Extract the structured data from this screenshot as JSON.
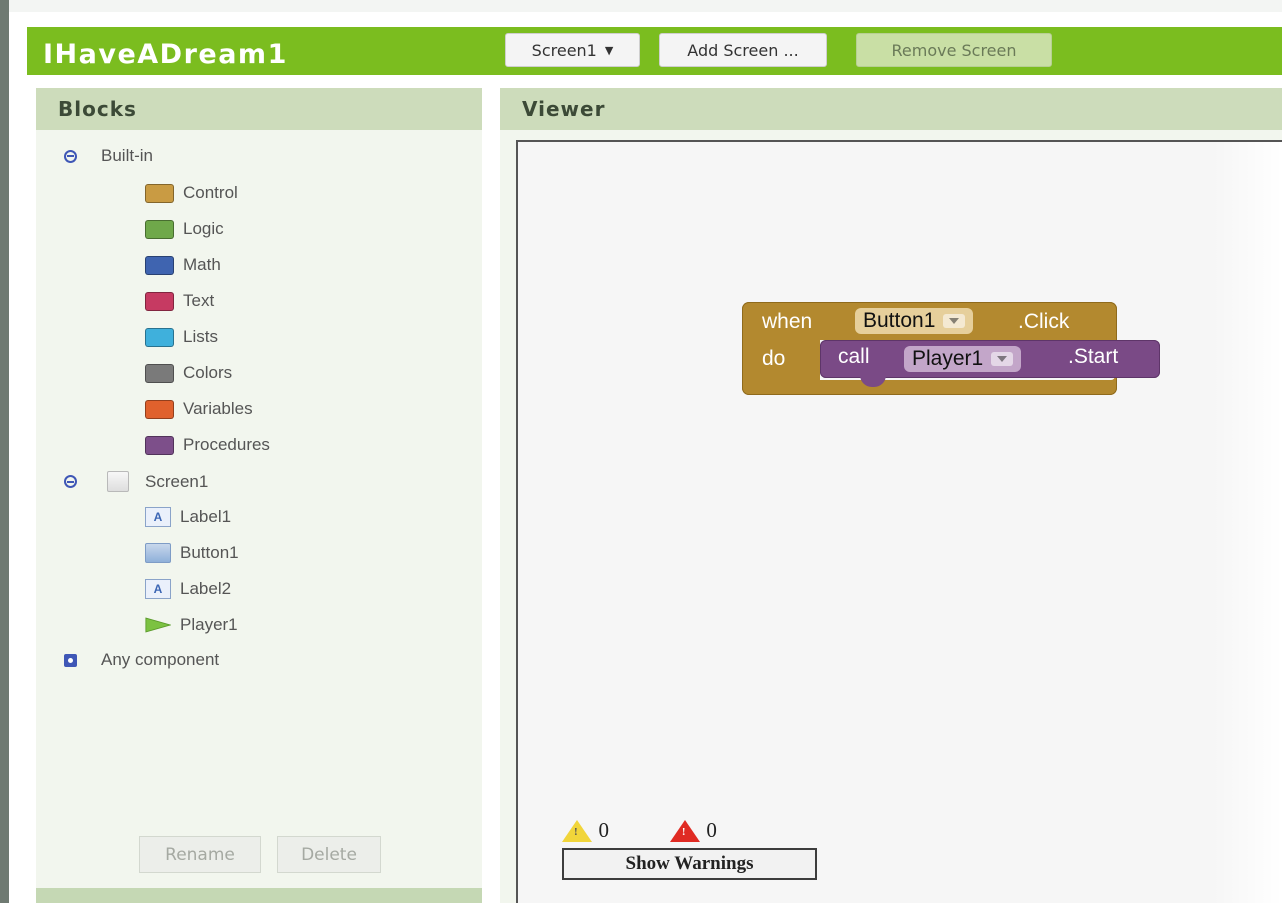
{
  "app": {
    "title": "IHaveADream1"
  },
  "toolbar": {
    "screen_select": "Screen1",
    "add_screen": "Add Screen ...",
    "remove_screen": "Remove Screen"
  },
  "blocks_panel": {
    "header": "Blocks",
    "builtin_label": "Built-in",
    "builtin_items": [
      {
        "label": "Control",
        "color": "#c99b43"
      },
      {
        "label": "Logic",
        "color": "#6fa84a"
      },
      {
        "label": "Math",
        "color": "#3f64b0"
      },
      {
        "label": "Text",
        "color": "#c63a62"
      },
      {
        "label": "Lists",
        "color": "#3fb0dc"
      },
      {
        "label": "Colors",
        "color": "#7a7a7a"
      },
      {
        "label": "Variables",
        "color": "#e0612d"
      },
      {
        "label": "Procedures",
        "color": "#7d4f8a"
      }
    ],
    "screen_label": "Screen1",
    "components": [
      {
        "label": "Label1",
        "icon": "label-icon"
      },
      {
        "label": "Button1",
        "icon": "button-icon"
      },
      {
        "label": "Label2",
        "icon": "label-icon"
      },
      {
        "label": "Player1",
        "icon": "player-icon"
      }
    ],
    "any_component": "Any component",
    "rename": "Rename",
    "delete": "Delete"
  },
  "viewer": {
    "header": "Viewer",
    "event_block": {
      "when": "when",
      "component": "Button1",
      "event": ".Click",
      "do": "do"
    },
    "call_block": {
      "call": "call",
      "component": "Player1",
      "method": ".Start"
    },
    "warnings_count": "0",
    "errors_count": "0",
    "show_warnings": "Show Warnings"
  }
}
